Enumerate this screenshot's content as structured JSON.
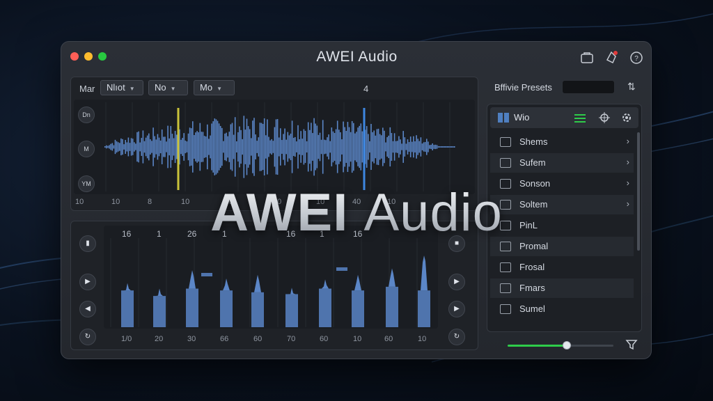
{
  "app": {
    "title": "AWEI Audio"
  },
  "overlay": {
    "brand_bold": "AWEI",
    "brand_light": "Audio"
  },
  "colors": {
    "accent_green": "#2ecc4a",
    "wave_blue": "#5b86c7",
    "marker_yellow": "#c9c23a",
    "marker_blue": "#3d86e0"
  },
  "toolbar": {
    "label_mar": "Mar",
    "dropdown_1": "Nlıot",
    "dropdown_2": "No",
    "dropdown_3": "Mo",
    "counter": "4"
  },
  "wave_side": {
    "btn_top": "Dn",
    "btn_mid": "M",
    "btn_bot": "YM"
  },
  "wave_axis": [
    "10",
    "10",
    "8",
    "10",
    "10",
    "10",
    "10",
    "40",
    "10"
  ],
  "eq_top_labels": [
    "16",
    "1",
    "26",
    "1",
    "16",
    "1",
    "16"
  ],
  "eq_bottom_labels": [
    "1/0",
    "20",
    "30",
    "66",
    "60",
    "70",
    "60",
    "10",
    "60",
    "10"
  ],
  "eq_bars": {
    "tall": [
      0.48,
      0.42,
      0.62,
      0.53,
      0.57,
      0.43,
      0.52,
      0.57,
      0.64,
      0.78
    ],
    "main": [
      0.4,
      0.34,
      0.42,
      0.4,
      0.38,
      0.36,
      0.42,
      0.4,
      0.44,
      0.4
    ]
  },
  "presets": {
    "title": "Bffivie Presets",
    "header_label": "Wio",
    "items": [
      {
        "label": "Shems",
        "icon": "back-icon",
        "chevron": true
      },
      {
        "label": "Sufem",
        "icon": "waveform-icon",
        "chevron": true
      },
      {
        "label": "Sonson",
        "icon": "image-icon",
        "chevron": true
      },
      {
        "label": "Soltem",
        "icon": "check-icon",
        "chevron": true
      },
      {
        "label": "PinL",
        "icon": "list-icon",
        "chevron": false
      },
      {
        "label": "Promal",
        "icon": "list-icon",
        "chevron": false
      },
      {
        "label": "Frosal",
        "icon": "box-icon",
        "chevron": false
      },
      {
        "label": "Fmars",
        "icon": "doc-icon",
        "chevron": false
      },
      {
        "label": "Sumel",
        "icon": "monitor-icon",
        "chevron": false
      }
    ]
  },
  "volume": {
    "level": 0.56
  }
}
